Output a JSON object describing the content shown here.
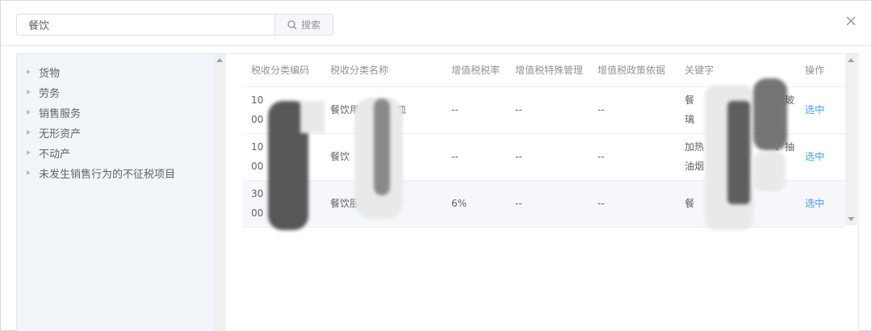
{
  "search": {
    "value": "餐饮",
    "button_label": "搜索"
  },
  "tree": {
    "items": [
      {
        "label": "货物"
      },
      {
        "label": "劳务"
      },
      {
        "label": "销售服务"
      },
      {
        "label": "无形资产"
      },
      {
        "label": "不动产"
      },
      {
        "label": "未发生销售行为的不征税项目"
      }
    ]
  },
  "table": {
    "headers": [
      "税收分类编码",
      "税收分类名称",
      "增值税税率",
      "增值税特殊管理",
      "增值税政策依据",
      "关键字",
      "操作"
    ],
    "rows": [
      {
        "code_line1": "10",
        "code_line2": "00",
        "name": "餐饮用",
        "name_tail": "皿",
        "rate": "--",
        "special": "--",
        "policy": "--",
        "keyword_line1": "餐",
        "keyword_tail": "玻",
        "keyword_line2": "璃",
        "action": "选中"
      },
      {
        "code_line1": "10",
        "code_line2": "00",
        "name": "餐饮",
        "name_tail": "械",
        "rate": "--",
        "special": "--",
        "policy": "--",
        "keyword_line1": "加热",
        "keyword_tail": "、抽",
        "keyword_line2": "油烟",
        "action": "选中"
      },
      {
        "code_line1": "30",
        "code_line2": "00",
        "name": "餐饮服务",
        "name_tail": "",
        "rate": "6%",
        "special": "--",
        "policy": "--",
        "keyword_line1": "餐",
        "keyword_tail": "",
        "keyword_line2": "",
        "action": "选中"
      }
    ]
  },
  "icons": {
    "search": "search-icon",
    "close": "close-icon"
  },
  "colors": {
    "accent": "#409eff",
    "tree_bg": "#f2f6fa",
    "row_highlight": "#f5f7fa"
  }
}
